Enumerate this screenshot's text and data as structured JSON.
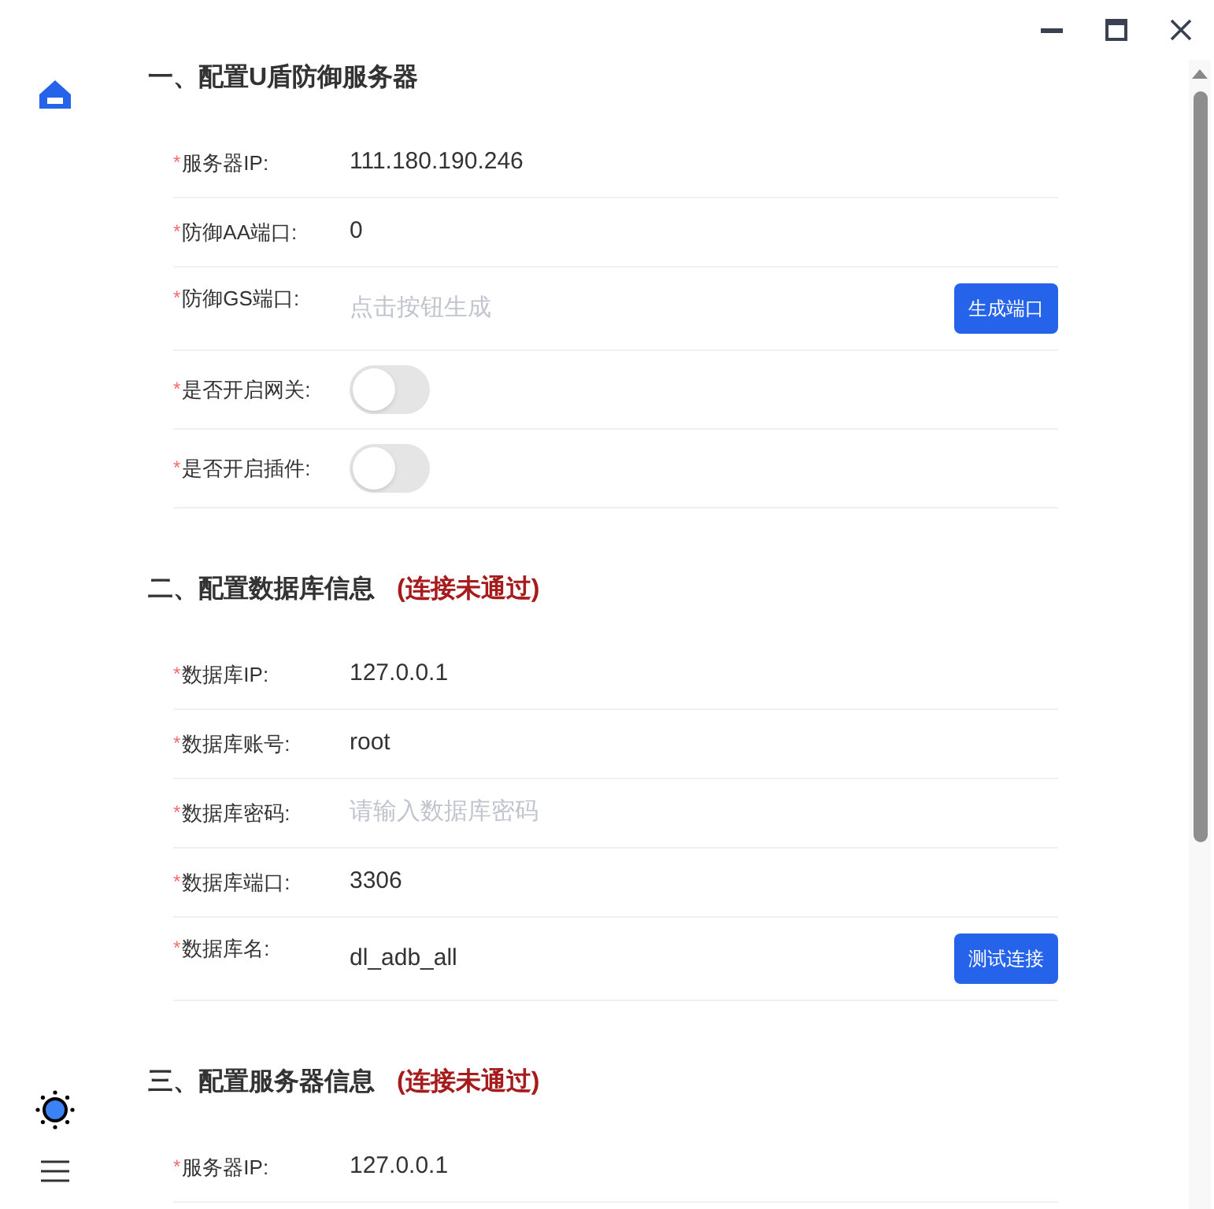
{
  "sections": [
    {
      "title": "一、配置U盾防御服务器",
      "rows": [
        {
          "label": "服务器IP:",
          "required_mark": "*",
          "kind": "text",
          "value": "111.180.190.246"
        },
        {
          "label": "防御AA端口:",
          "required_mark": "*",
          "kind": "text",
          "value": "0"
        },
        {
          "label": "防御GS端口:",
          "required_mark": "*",
          "kind": "placeholder",
          "placeholder": "点击按钮生成",
          "button": "生成端口"
        },
        {
          "label": "是否开启网关:",
          "required_mark": "*",
          "kind": "toggle",
          "on": false
        },
        {
          "label": "是否开启插件:",
          "required_mark": "*",
          "kind": "toggle",
          "on": false
        }
      ]
    },
    {
      "title": "二、配置数据库信息",
      "status": "(连接未通过)",
      "rows": [
        {
          "label": "数据库IP:",
          "required_mark": "*",
          "kind": "text",
          "value": "127.0.0.1"
        },
        {
          "label": "数据库账号:",
          "required_mark": "*",
          "kind": "text",
          "value": "root"
        },
        {
          "label": "数据库密码:",
          "required_mark": "*",
          "kind": "placeholder",
          "placeholder": "请输入数据库密码"
        },
        {
          "label": "数据库端口:",
          "required_mark": "*",
          "kind": "text",
          "value": "3306"
        },
        {
          "label": "数据库名:",
          "required_mark": "*",
          "kind": "text",
          "value": "dl_adb_all",
          "button": "测试连接"
        }
      ]
    },
    {
      "title": "三、配置服务器信息",
      "status": "(连接未通过)",
      "rows": [
        {
          "label": "服务器IP:",
          "required_mark": "*",
          "kind": "text",
          "value": "127.0.0.1"
        }
      ]
    }
  ]
}
